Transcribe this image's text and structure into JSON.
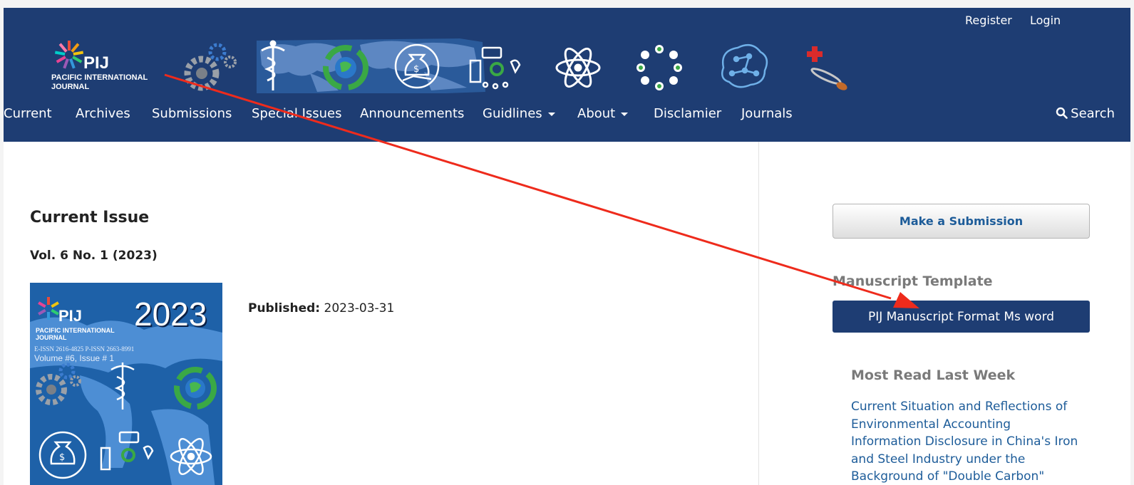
{
  "header": {
    "user_links": {
      "register": "Register",
      "login": "Login"
    },
    "logo": {
      "mark": "PIJ",
      "name_line1": "PACIFIC INTERNATIONAL",
      "name_line2": "JOURNAL"
    }
  },
  "nav": {
    "items": [
      {
        "label": "Current",
        "dropdown": false
      },
      {
        "label": "Archives",
        "dropdown": false
      },
      {
        "label": "Submissions",
        "dropdown": false
      },
      {
        "label": "Special Issues",
        "dropdown": false
      },
      {
        "label": "Announcements",
        "dropdown": false
      },
      {
        "label": "Guidlines",
        "dropdown": true
      },
      {
        "label": "About",
        "dropdown": true
      },
      {
        "label": "Disclamier",
        "dropdown": false
      },
      {
        "label": "Journals",
        "dropdown": false
      }
    ],
    "search_label": "Search"
  },
  "main": {
    "heading": "Current Issue",
    "volume": "Vol. 6 No. 1 (2023)",
    "published_label": "Published:",
    "published_date": "2023-03-31",
    "cover": {
      "logo_mark": "PIJ",
      "year": "2023",
      "journal_line1": "PACIFIC INTERNATIONAL",
      "journal_line2": "JOURNAL",
      "issn": "E-ISSN  2616-4825    P-ISSN  2663-8991",
      "volume_text": "Volume #6, Issue # 1"
    }
  },
  "sidebar": {
    "submit_button": "Make a Submission",
    "template_title": "Manuscript Template",
    "template_button": "PIJ Manuscript Format Ms word",
    "most_read_title": "Most Read Last Week",
    "most_read_link": "Current Situation and Reflections of Environmental Accounting Information Disclosure in China's Iron and Steel Industry under the Background of \"Double Carbon\""
  },
  "colors": {
    "header_bg": "#1e3d73",
    "link": "#1d5c99",
    "annotation_arrow": "#ee2b1c"
  },
  "icons": [
    "search-icon",
    "caret-down-icon",
    "gear-icon",
    "caduceus-icon",
    "recycle-globe-icon",
    "money-bag-icon",
    "logistics-icon",
    "atom-icon",
    "agriculture-icon",
    "brain-icon",
    "medical-icon"
  ]
}
